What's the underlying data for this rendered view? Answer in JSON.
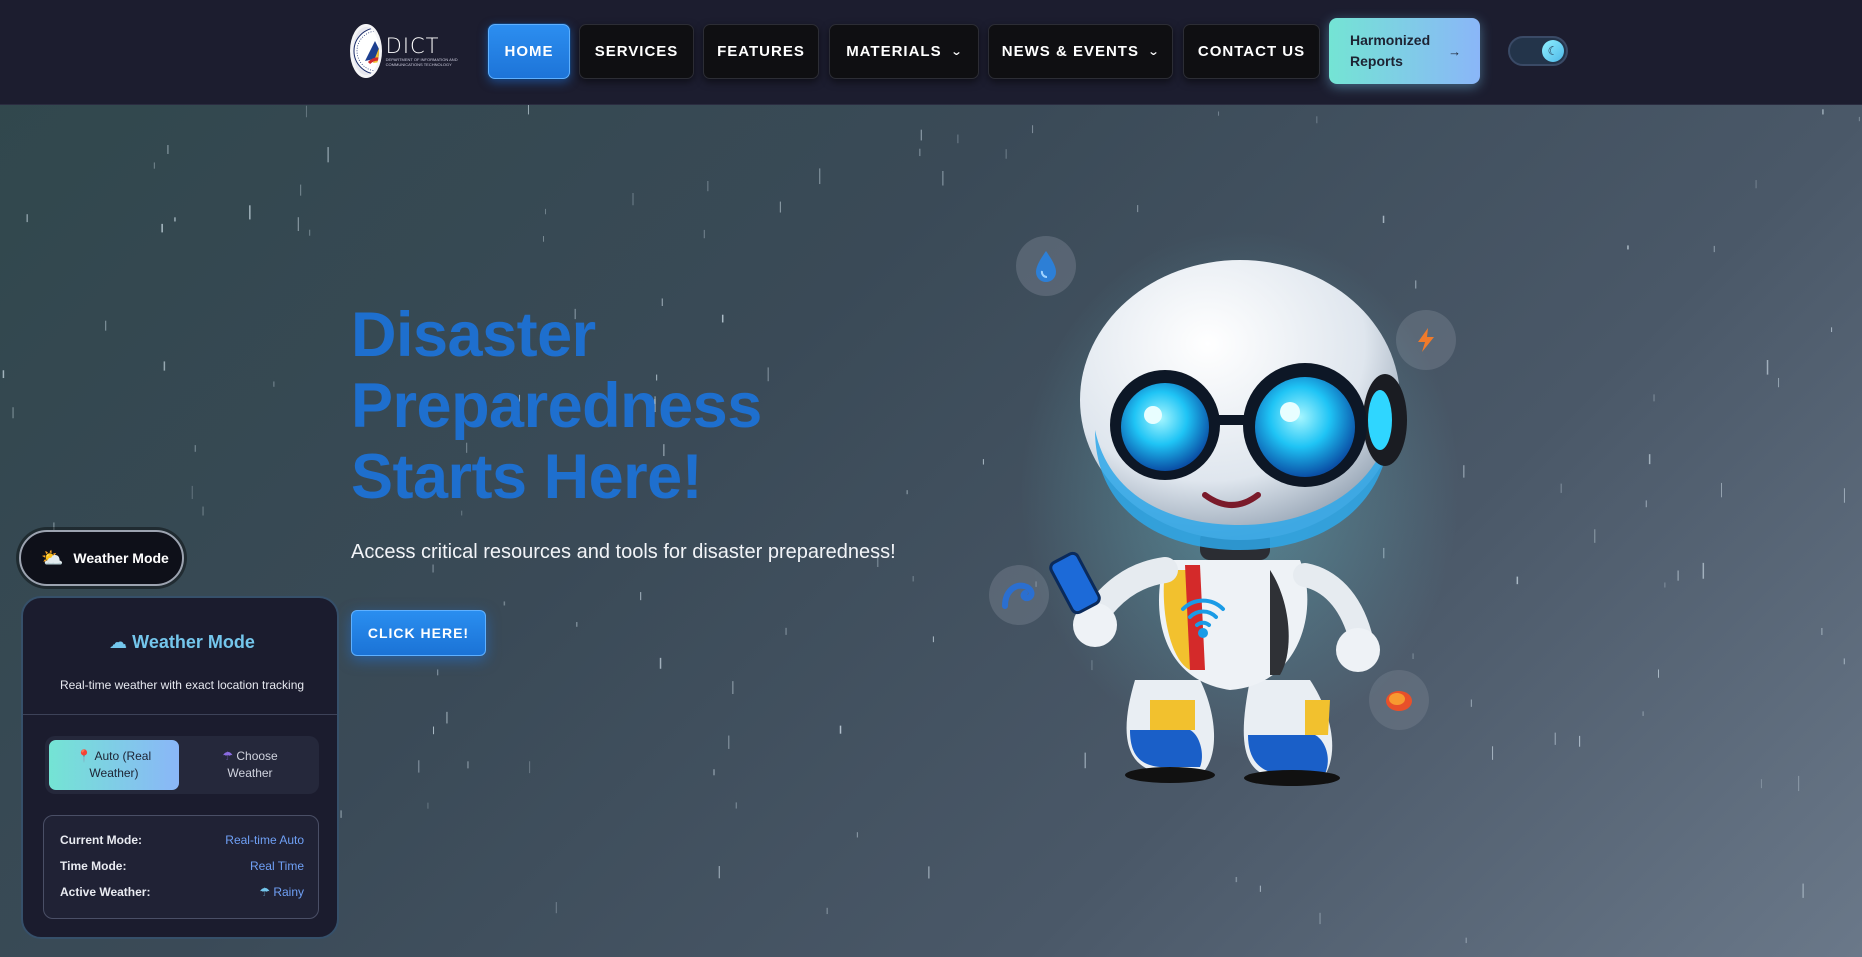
{
  "header": {
    "logo_text": "DICT",
    "logo_subtext": "DEPARTMENT OF INFORMATION AND COMMUNICATIONS TECHNOLOGY",
    "nav": {
      "home": "HOME",
      "services": "SERVICES",
      "features": "FEATURES",
      "materials": "MATERIALS",
      "news_events": "NEWS & EVENTS",
      "contact_us": "CONTACT US"
    },
    "active_nav": "home",
    "cta_line1": "Harmonized",
    "cta_line2": "Reports",
    "cta_arrow": "→",
    "theme_toggle_icon": "moon-icon"
  },
  "hero": {
    "title_line1": "Disaster",
    "title_line2": "Preparedness",
    "title_line3": "Starts Here!",
    "subtitle": "Access critical resources and tools for disaster preparedness!",
    "button_label": "CLICK HERE!"
  },
  "weather": {
    "toggle_label": "Weather Mode",
    "panel_title": "Weather Mode",
    "panel_desc": "Real-time weather with exact location tracking",
    "option_auto": "Auto (Real Weather)",
    "option_choose": "Choose Weather",
    "selected_option": "auto",
    "rows": [
      {
        "key": "Current Mode:",
        "value": "Real-time Auto"
      },
      {
        "key": "Time Mode:",
        "value": "Real Time"
      },
      {
        "key": "Active Weather:",
        "value": "Rainy"
      }
    ]
  },
  "colors": {
    "accent": "#1d74d8",
    "title": "#1e6fce",
    "cta_gradient_start": "#74e4d4",
    "cta_gradient_end": "#8ab6f8",
    "panel_title": "#74c6ec"
  }
}
